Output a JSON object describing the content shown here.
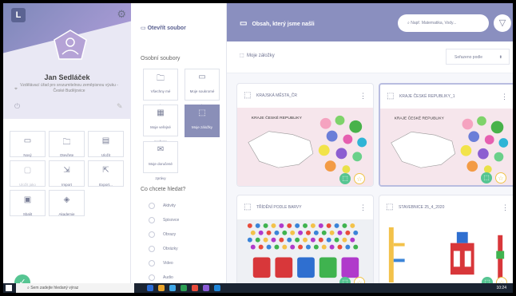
{
  "user": {
    "name": "Jan Sedláček",
    "school": "Vzdělávací úřad pro srozumitelnou zeměpisnou výuku - České Budějovice"
  },
  "tiles": [
    {
      "label": "Nový",
      "icon": "new-icon",
      "disabled": false
    },
    {
      "label": "Otevřete",
      "icon": "open-folder-icon",
      "disabled": false
    },
    {
      "label": "Uložit",
      "icon": "save-icon",
      "disabled": false
    },
    {
      "label": "Uložit jako",
      "icon": "save-as-icon",
      "disabled": true
    },
    {
      "label": "Import",
      "icon": "import-icon",
      "disabled": false
    },
    {
      "label": "Export...",
      "icon": "export-icon",
      "disabled": false
    },
    {
      "label": "Sbalit",
      "icon": "collapse-icon",
      "disabled": false
    },
    {
      "label": "Akademie",
      "icon": "academy-icon",
      "disabled": false
    }
  ],
  "middle": {
    "open_label": "Otevřít soubor",
    "own_files_header": "Osobní soubory",
    "own_files": [
      {
        "label": "Všechny mé soubory",
        "icon": "all-files-icon",
        "active": false
      },
      {
        "label": "Moje soukromé soubory",
        "icon": "private-files-icon",
        "active": false
      },
      {
        "label": "Moje veřejné soubory",
        "icon": "public-files-icon",
        "active": false
      },
      {
        "label": "Moje záložky",
        "icon": "bookmark-icon",
        "active": true
      },
      {
        "label": "Moje doručené zprávy",
        "icon": "inbox-icon",
        "active": false
      }
    ],
    "search_header": "Co chcete hledat?",
    "options": [
      "Aktivity",
      "Spisovce",
      "Obrazy",
      "Obrázky",
      "Video",
      "Audio",
      "Lekce"
    ],
    "selected_option": "Lekce"
  },
  "topbar": {
    "title": "Obsah, který jsme našli",
    "search_placeholder": "Např. Matematika, Vody..."
  },
  "bookmarks_label": "Moje záložky",
  "sort_label": "Seřazeno podle",
  "cards": [
    {
      "title": "KRAJSKÁ MĚSTA_ČR",
      "kind": "map"
    },
    {
      "title": "KRAJE ČESKÉ REPUBLIKY_1",
      "kind": "map"
    },
    {
      "title": "TŘÍDĚNÍ PODLE BARVY",
      "kind": "balls"
    },
    {
      "title": "STAVEBNICE 25_4_2020",
      "kind": "blocks"
    }
  ],
  "map_caption": "KRAJE ČESKÉ REPUBLIKY",
  "taskbar": {
    "search": "Sem zadejte hledaný výraz",
    "time": "10:24"
  },
  "colors": {
    "accent": "#8a8fbf",
    "green": "#56c592",
    "star": "#f0c44a"
  }
}
